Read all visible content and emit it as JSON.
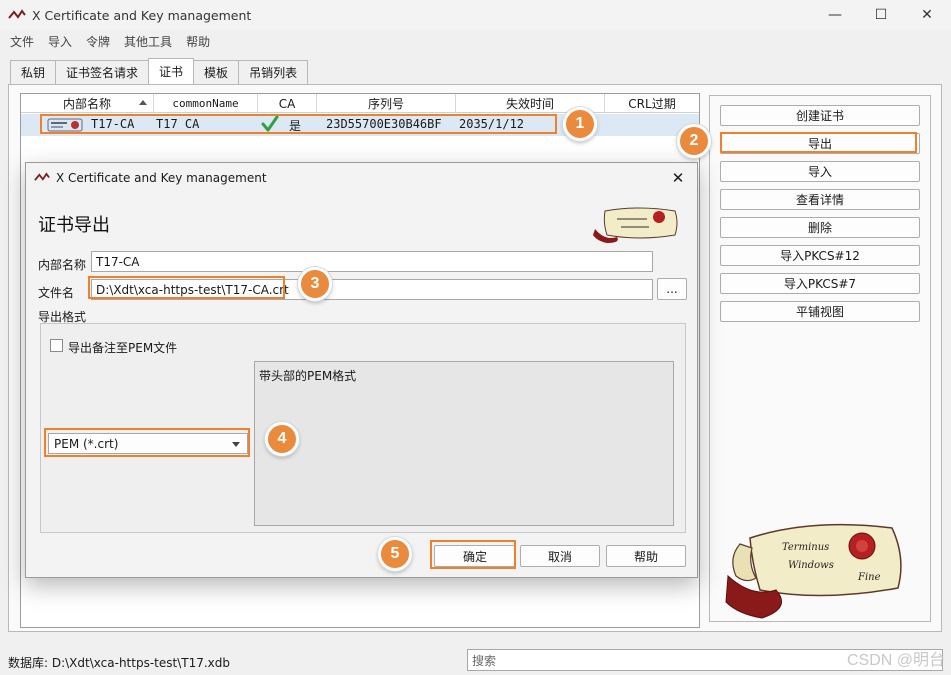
{
  "window": {
    "title": "X Certificate and Key management",
    "controls": {
      "minimize": "—",
      "maximize": "☐",
      "close": "✕"
    }
  },
  "menu": [
    "文件",
    "导入",
    "令牌",
    "其他工具",
    "帮助"
  ],
  "tabs": [
    {
      "label": "私钥",
      "active": false
    },
    {
      "label": "证书签名请求",
      "active": false
    },
    {
      "label": "证书",
      "active": true
    },
    {
      "label": "模板",
      "active": false
    },
    {
      "label": "吊销列表",
      "active": false
    }
  ],
  "table": {
    "columns": [
      "内部名称",
      "commonName",
      "CA",
      "序列号",
      "失效时间",
      "CRL过期"
    ],
    "rows": [
      {
        "internal_name": "T17-CA",
        "common_name": "T17 CA",
        "ca": "是",
        "serial": "23D55700E30B46BF",
        "expiry": "2035/1/12",
        "crl_expiry": ""
      }
    ]
  },
  "side_buttons": [
    "创建证书",
    "导出",
    "导入",
    "查看详情",
    "删除",
    "导入PKCS#12",
    "导入PKCS#7",
    "平铺视图"
  ],
  "dialog": {
    "title": "X Certificate and Key management",
    "heading": "证书导出",
    "internal_name_label": "内部名称",
    "internal_name_value": "T17-CA",
    "filename_label": "文件名",
    "filename_value": "D:\\Xdt\\xca-https-test\\T17-CA.crt",
    "browse_label": "...",
    "format_group_label": "导出格式",
    "checkbox_label": "导出备注至PEM文件",
    "checkbox_checked": false,
    "format_selected": "PEM (*.crt)",
    "format_description": "带头部的PEM格式",
    "ok_label": "确定",
    "cancel_label": "取消",
    "help_label": "帮助"
  },
  "callouts": [
    "1",
    "2",
    "3",
    "4",
    "5"
  ],
  "status": {
    "database": "数据库: D:\\Xdt\\xca-https-test\\T17.xdb",
    "search_placeholder": "搜索"
  },
  "watermark": "CSDN @明台",
  "logo_text": [
    "Terminus",
    "Windows",
    "Fine"
  ],
  "colors": {
    "accent_callout": "#f0812a",
    "badge": "#e98a3c",
    "selection": "#dde8f5",
    "check": "#2ea043"
  }
}
